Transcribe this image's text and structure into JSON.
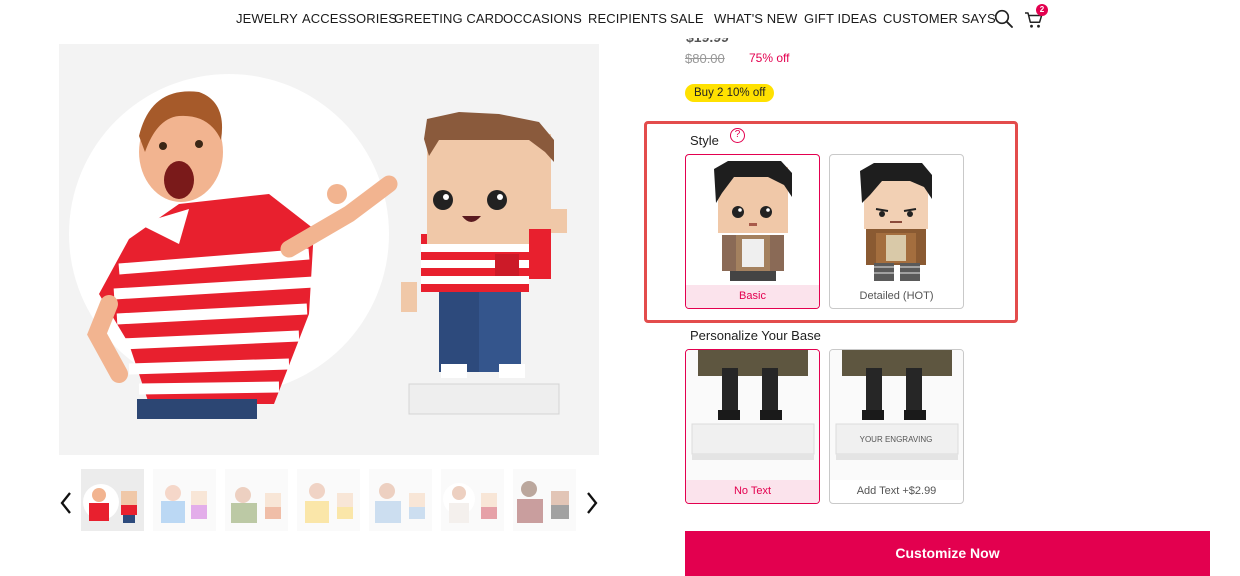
{
  "nav": {
    "items": [
      "JEWELRY",
      "ACCESSORIES",
      "GREETING CARD",
      "OCCASIONS",
      "RECIPIENTS",
      "SALE",
      "WHAT'S NEW",
      "GIFT IDEAS",
      "CUSTOMER SAYS"
    ],
    "cart_count": "2",
    "icons": [
      "search-icon",
      "cart-icon"
    ]
  },
  "pricing": {
    "original": "$80.00",
    "discount": "75% off",
    "promo": "Buy 2 10% off"
  },
  "style": {
    "label": "Style",
    "help": "?",
    "options": [
      "Basic",
      "Detailed (HOT)"
    ],
    "selected": "Basic"
  },
  "base": {
    "label": "Personalize Your Base",
    "options": [
      "No Text",
      "Add Text +$2.99"
    ],
    "selected": "No Text",
    "engraving_sample": "YOUR ENGRAVING"
  },
  "cta": {
    "label": "Customize Now"
  },
  "colors": {
    "accent": "#e3004f",
    "highlight": "#e34c4c",
    "promo": "#ffe100"
  }
}
